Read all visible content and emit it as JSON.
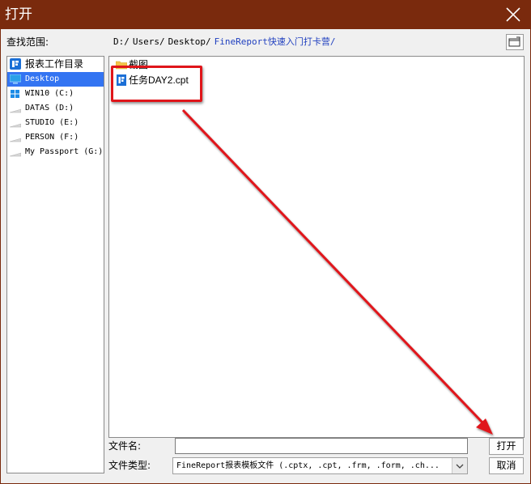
{
  "window": {
    "title": "打开"
  },
  "lookin": {
    "label": "查找范围:",
    "path": [
      "D:/",
      "Users/",
      "Desktop/",
      "FineReport快速入门打卡营/"
    ]
  },
  "places": [
    {
      "label": "报表工作目录",
      "icon": "finereport-icon"
    },
    {
      "label": "Desktop",
      "icon": "desktop-icon",
      "selected": true
    },
    {
      "label": "WIN10 (C:)",
      "icon": "windows-drive-icon"
    },
    {
      "label": "DATAS (D:)",
      "icon": "drive-icon"
    },
    {
      "label": "STUDIO (E:)",
      "icon": "drive-icon"
    },
    {
      "label": "PERSON (F:)",
      "icon": "drive-icon"
    },
    {
      "label": "My Passport (G:)",
      "icon": "drive-icon"
    }
  ],
  "files": [
    {
      "name": "截图",
      "icon": "folder-icon"
    },
    {
      "name": "任务DAY2.cpt",
      "icon": "cpt-file-icon"
    }
  ],
  "filename": {
    "label": "文件名:",
    "value": ""
  },
  "filetype": {
    "label": "文件类型:",
    "value": "FineReport报表模板文件 (.cptx, .cpt, .frm, .form, .ch..."
  },
  "buttons": {
    "open": "打开",
    "cancel": "取消"
  },
  "colors": {
    "titlebar": "#7a2a0d",
    "selection": "#3374f2",
    "annotation": "#e0151a",
    "path_link": "#1f3fbf"
  }
}
